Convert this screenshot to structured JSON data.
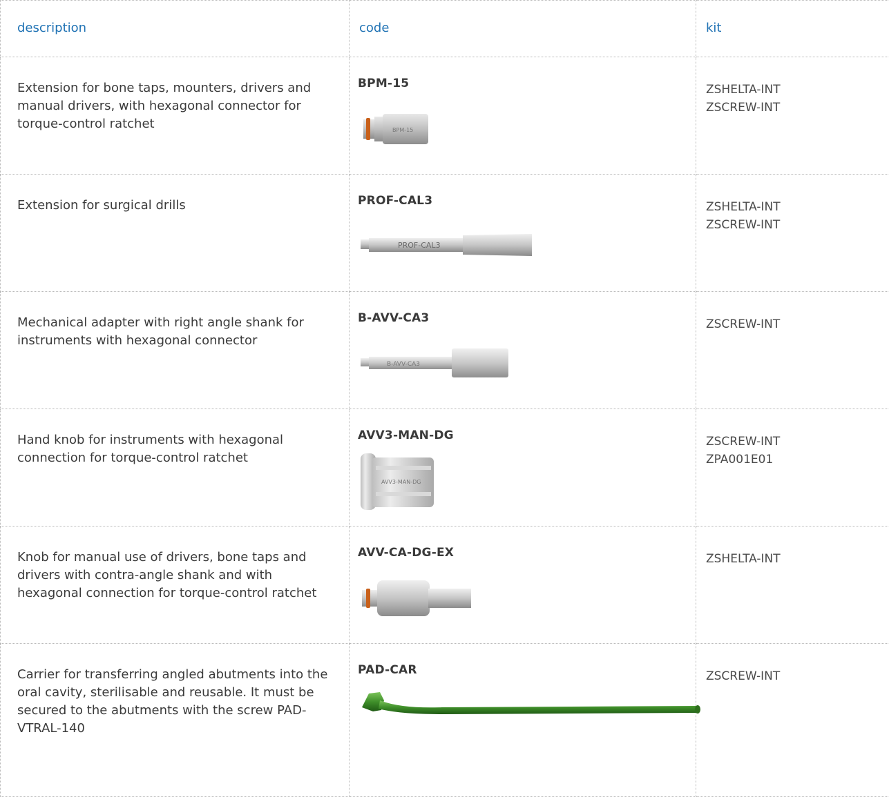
{
  "headers": {
    "description": "description",
    "code": "code",
    "kit": "kit"
  },
  "rows": [
    {
      "description": "Extension for bone taps, mounters, drivers and manual drivers, with hexagonal connector for torque-control ratchet",
      "code": "BPM-15",
      "image_label": "BPM-15",
      "kits": [
        "ZSHELTA-INT",
        "ZSCREW-INT"
      ]
    },
    {
      "description": "Extension for surgical drills",
      "code": "PROF-CAL3",
      "image_label": "PROF-CAL3",
      "kits": [
        "ZSHELTA-INT",
        "ZSCREW-INT"
      ]
    },
    {
      "description": "Mechanical adapter with right angle shank for instruments with hexagonal connector",
      "code": "B-AVV-CA3",
      "image_label": "B-AVV-CA3",
      "kits": [
        "ZSCREW-INT"
      ]
    },
    {
      "description": "Hand knob for instruments with hexagonal connection for torque-control ratchet",
      "code": "AVV3-MAN-DG",
      "image_label": "AVV3-MAN-DG",
      "kits": [
        "ZSCREW-INT",
        "ZPA001E01"
      ]
    },
    {
      "description": "Knob for manual use of drivers, bone taps and drivers with contra-angle shank and with hexagonal connection for torque-control ratchet",
      "code": "AVV-CA-DG-EX",
      "kits": [
        "ZSHELTA-INT"
      ]
    },
    {
      "description": "Carrier for transferring angled abutments into the oral cavity, sterilisable and reusable. It must be secured to the abutments with the screw PAD-VTRAL-140",
      "code": "PAD-CAR",
      "kits": [
        "ZSCREW-INT"
      ]
    }
  ],
  "colors": {
    "header_text": "#1f72b4",
    "body_text": "#3b3b3b",
    "border": "#b9b9b9",
    "orange_ring": "#c8601a",
    "green_carrier": "#3f8f2a"
  }
}
